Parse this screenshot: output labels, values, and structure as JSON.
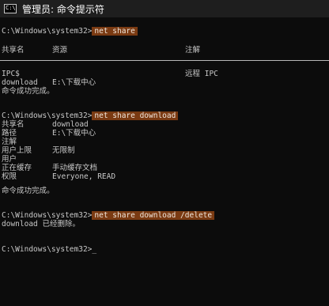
{
  "window": {
    "title": "管理员: 命令提示符",
    "icon": "cmd-icon",
    "icon_text": "C:\\"
  },
  "lines": {
    "prompt1": "C:\\Windows\\system32>",
    "cmd1": "net share",
    "hdr_name": "共享名",
    "hdr_resource": "资源",
    "hdr_remark": "注解",
    "ipc_name": "IPC$",
    "ipc_remark": "远程 IPC",
    "dl_name": "download",
    "dl_resource": "E:\\下载中心",
    "done1": "命令成功完成。",
    "prompt2": "C:\\Windows\\system32>",
    "cmd2": "net share download",
    "k_share": "共享名",
    "v_share": "download",
    "k_path": "路径",
    "v_path": "E:\\下载中心",
    "k_remark": "注解",
    "k_limit": "用户上限",
    "v_limit": "无限制",
    "k_users": "用户",
    "k_cache": "正在缓存",
    "v_cache": "手动缓存文档",
    "k_perm": "权限",
    "v_perm": "Everyone, READ",
    "done2": "命令成功完成。",
    "prompt3": "C:\\Windows\\system32>",
    "cmd3": "net share download /delete",
    "deleted": "download 已经删除。",
    "prompt4": "C:\\Windows\\system32>",
    "cursor": "_"
  },
  "colors": {
    "background": "#0c0c0c",
    "text": "#cccccc",
    "command_highlight": "#7a3a12"
  }
}
